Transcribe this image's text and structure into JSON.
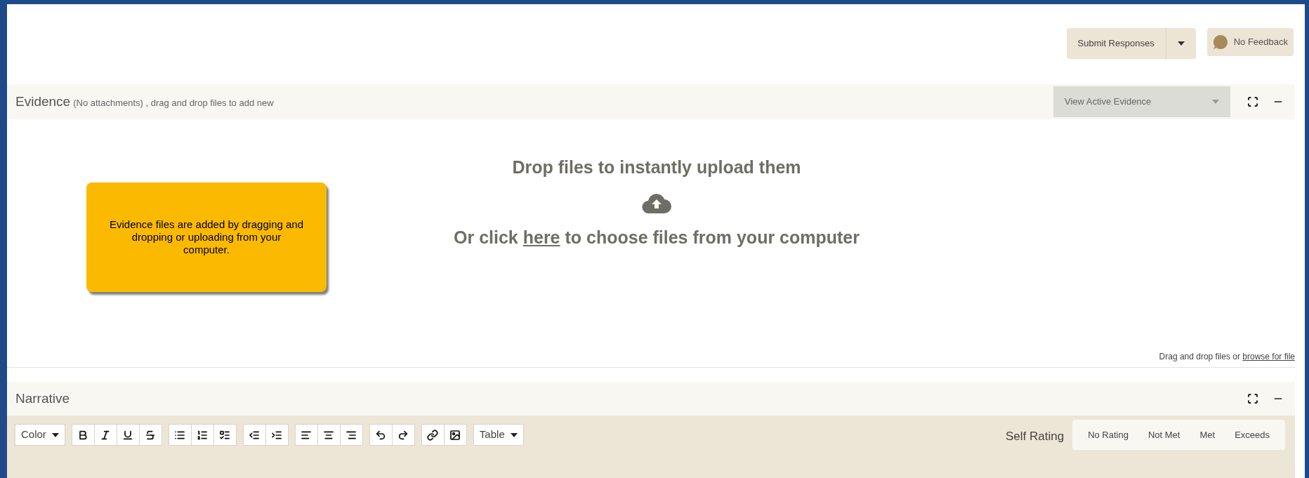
{
  "actions": {
    "submit": {
      "label": "Submit Responses"
    },
    "feedback": {
      "label": "No Feedback"
    }
  },
  "evidence": {
    "title": "Evidence",
    "subtitle": "(No attachments) , drag and drop files to add new",
    "view_select": {
      "value": "View Active Evidence"
    },
    "note": "Evidence files are added by dragging and dropping or uploading from your computer.",
    "drop_heading": "Drop files to instantly upload them",
    "drop_prefix": "Or click",
    "drop_link": "here",
    "drop_suffix": "to choose files from your computer",
    "footer_prefix": "Drag and drop files or",
    "footer_link": "browse for file"
  },
  "narrative": {
    "title": "Narrative",
    "toolbar": {
      "color_label": "Color",
      "table_label": "Table"
    },
    "self_rating": {
      "label": "Self Rating",
      "options": [
        {
          "label": "No Rating",
          "selected": false
        },
        {
          "label": "Not Met",
          "selected": false
        },
        {
          "label": "Met",
          "selected": false
        },
        {
          "label": "Exceeds",
          "selected": false
        }
      ]
    }
  }
}
